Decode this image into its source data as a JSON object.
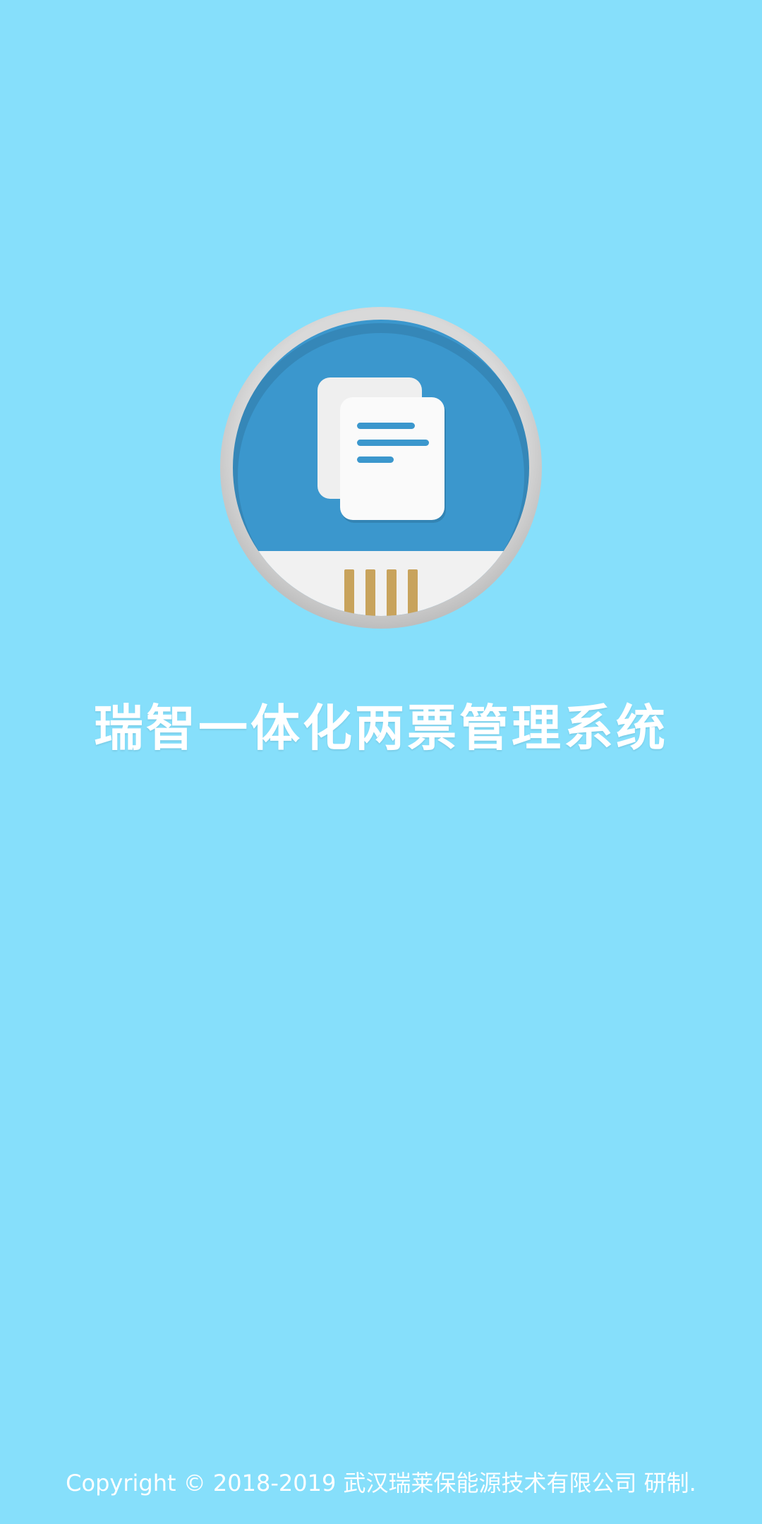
{
  "app": {
    "title": "瑞智一体化两票管理系统",
    "copyright": "Copyright © 2018-2019 武汉瑞莱保能源技术有限公司 研制."
  },
  "logo": {
    "icon": "document-card-reader-icon"
  },
  "colors": {
    "background": "#86dffb",
    "logo_blue": "#3b97cd",
    "logo_ring": "#cdcdcd",
    "contacts_gold": "#c8a35c",
    "text": "#ffffff"
  }
}
